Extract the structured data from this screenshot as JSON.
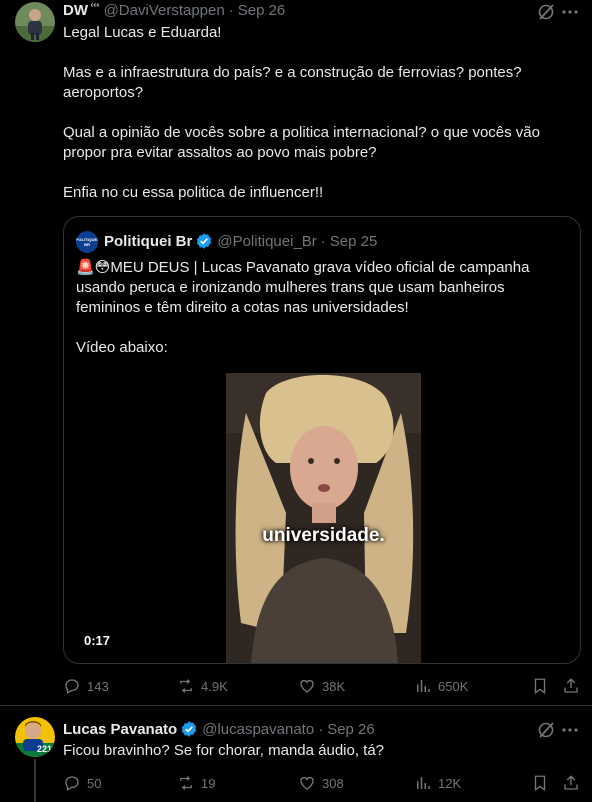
{
  "tweet1": {
    "display_name": "DW",
    "badge": "ᶜᶜᶜ",
    "handle": "@DaviVerstappen",
    "dot": "·",
    "date": "Sep 26",
    "text": "Legal Lucas e Eduarda!\n\nMas e a infraestrutura do país? e a construção de ferrovias? pontes? aeroportos?\n\nQual a opinião de vocês sobre a politica internacional? o que vocês vão propor pra evitar assaltos ao povo mais pobre?\n\nEnfia no cu essa politica de influencer!!",
    "quote": {
      "avatar_text": "POLITIQUEI BR",
      "display_name": "Politiquei Br",
      "handle": "@Politiquei_Br",
      "dot": "·",
      "date": "Sep 25",
      "text": "🚨😳MEU DEUS | Lucas Pavanato grava vídeo oficial de campanha usando peruca e ironizando mulheres trans que usam banheiros femininos e têm direito a cotas nas universidades!\n\nVídeo abaixo:",
      "video_caption": "universidade.",
      "video_duration": "0:17"
    },
    "actions": {
      "replies": "143",
      "reposts": "4.9K",
      "likes": "38K",
      "views": "650K"
    }
  },
  "tweet2": {
    "display_name": "Lucas Pavanato",
    "handle": "@lucaspavanato",
    "dot": "·",
    "date": "Sep 26",
    "text": "Ficou bravinho? Se for chorar, manda áudio, tá?",
    "avatar_number": "2211",
    "actions": {
      "replies": "50",
      "reposts": "19",
      "likes": "308",
      "views": "12K"
    }
  },
  "icons": {
    "reply": "reply-icon",
    "repost": "repost-icon",
    "like": "like-icon",
    "views": "views-icon",
    "bookmark": "bookmark-icon",
    "share": "share-icon",
    "grok": "grok-icon",
    "more": "more-icon",
    "verified": "verified-badge-icon"
  },
  "colors": {
    "background": "#000000",
    "text": "#e7e9ea",
    "secondary": "#71767b",
    "border": "#2f3336",
    "verified": "#1d9bf0"
  }
}
